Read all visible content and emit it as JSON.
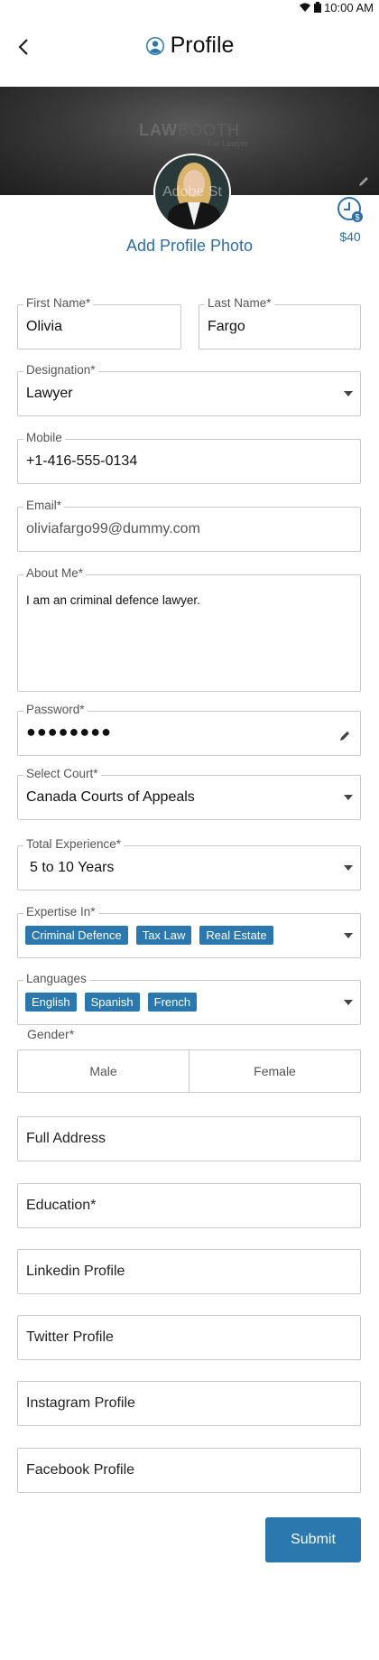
{
  "status_bar": {
    "time": "10:00 AM"
  },
  "header": {
    "title": "Profile"
  },
  "cover": {
    "brand_bold": "LAW",
    "brand_light": "BOOTH",
    "tagline": "For Lawyer"
  },
  "avatar": {
    "overlay_text": "Adobe St"
  },
  "wallet": {
    "amount": "$40",
    "icon": "clock-dollar-icon"
  },
  "add_photo_label": "Add Profile Photo",
  "form": {
    "first_name": {
      "label": "First Name*",
      "value": "Olivia"
    },
    "last_name": {
      "label": "Last Name*",
      "value": "Fargo"
    },
    "designation": {
      "label": "Designation*",
      "value": "Lawyer"
    },
    "mobile": {
      "label": "Mobile",
      "value": "+1-416-555-0134"
    },
    "email": {
      "label": "Email*",
      "value": "oliviafargo99@dummy.com"
    },
    "about_me": {
      "label": "About Me*",
      "value": "I am an criminal defence lawyer."
    },
    "password": {
      "label": "Password*",
      "value": "●●●●●●●●"
    },
    "court": {
      "label": "Select Court*",
      "value": "Canada Courts of Appeals"
    },
    "experience": {
      "label": "Total Experience*",
      "value": "5 to 10 Years"
    },
    "expertise": {
      "label": "Expertise In*",
      "chips": [
        "Criminal Defence",
        "Tax Law",
        "Real Estate"
      ]
    },
    "languages": {
      "label": "Languages",
      "chips": [
        "English",
        "Spanish",
        "French"
      ]
    },
    "gender": {
      "label": "Gender*",
      "options": [
        "Male",
        "Female"
      ]
    },
    "full_address": {
      "placeholder": "Full Address"
    },
    "education": {
      "placeholder": "Education*"
    },
    "linkedin": {
      "placeholder": "Linkedin Profile"
    },
    "twitter": {
      "placeholder": "Twitter Profile"
    },
    "instagram": {
      "placeholder": "Instagram Profile"
    },
    "facebook": {
      "placeholder": "Facebook Profile"
    }
  },
  "submit_label": "Submit",
  "colors": {
    "accent": "#2a78ad",
    "link": "#2c6fa8",
    "border": "#c9c9c9"
  }
}
